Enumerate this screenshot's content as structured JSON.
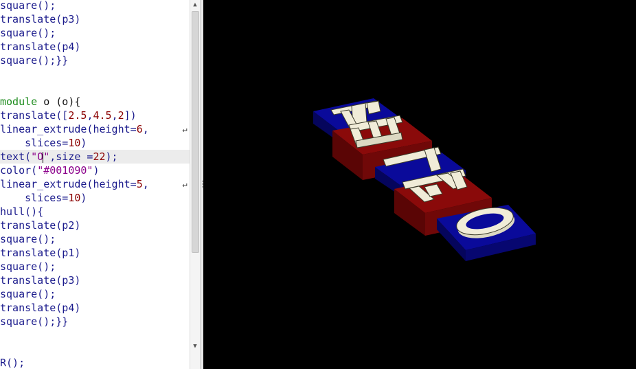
{
  "editor": {
    "lines": [
      {
        "segs": [
          {
            "t": "square();",
            "c": "fn"
          }
        ]
      },
      {
        "segs": [
          {
            "t": "translate(",
            "c": "fn"
          },
          {
            "t": "p3",
            "c": "fn"
          },
          {
            "t": ")",
            "c": "fn"
          }
        ]
      },
      {
        "segs": [
          {
            "t": "square();",
            "c": "fn"
          }
        ]
      },
      {
        "segs": [
          {
            "t": "translate(",
            "c": "fn"
          },
          {
            "t": "p4",
            "c": "fn"
          },
          {
            "t": ")",
            "c": "fn"
          }
        ]
      },
      {
        "segs": [
          {
            "t": "square();}}",
            "c": "fn"
          }
        ]
      },
      {
        "segs": []
      },
      {
        "segs": []
      },
      {
        "segs": [
          {
            "t": "module",
            "c": "kw"
          },
          {
            "t": " o (o){",
            "c": ""
          }
        ]
      },
      {
        "segs": [
          {
            "t": "translate([",
            "c": "fn"
          },
          {
            "t": "2.5",
            "c": "num"
          },
          {
            "t": ",",
            "c": "fn"
          },
          {
            "t": "4.5",
            "c": "num"
          },
          {
            "t": ",",
            "c": "fn"
          },
          {
            "t": "2",
            "c": "num"
          },
          {
            "t": "])",
            "c": "fn"
          }
        ]
      },
      {
        "segs": [
          {
            "t": "linear_extrude(height=",
            "c": "fn"
          },
          {
            "t": "6",
            "c": "num"
          },
          {
            "t": ",",
            "c": "fn"
          }
        ],
        "wrap": true
      },
      {
        "segs": [
          {
            "t": "    slices=",
            "c": "fn"
          },
          {
            "t": "10",
            "c": "num"
          },
          {
            "t": ")",
            "c": "fn"
          }
        ]
      },
      {
        "segs": [
          {
            "t": "text(",
            "c": "fn"
          },
          {
            "t": "\"O",
            "c": "str"
          },
          {
            "t": "CARET",
            "c": "caret"
          },
          {
            "t": "\"",
            "c": "str"
          },
          {
            "t": ",size =",
            "c": "fn"
          },
          {
            "t": "22",
            "c": "num"
          },
          {
            "t": ");",
            "c": "fn"
          }
        ],
        "current": true
      },
      {
        "segs": [
          {
            "t": "color(",
            "c": "fn"
          },
          {
            "t": "\"#001090\"",
            "c": "str"
          },
          {
            "t": ")",
            "c": "fn"
          }
        ]
      },
      {
        "segs": [
          {
            "t": "linear_extrude(height=",
            "c": "fn"
          },
          {
            "t": "5",
            "c": "num"
          },
          {
            "t": ",",
            "c": "fn"
          }
        ],
        "wrap": true
      },
      {
        "segs": [
          {
            "t": "    slices=",
            "c": "fn"
          },
          {
            "t": "10",
            "c": "num"
          },
          {
            "t": ")",
            "c": "fn"
          }
        ]
      },
      {
        "segs": [
          {
            "t": "hull(){",
            "c": "fn"
          }
        ]
      },
      {
        "segs": [
          {
            "t": "translate(p2)",
            "c": "fn"
          }
        ]
      },
      {
        "segs": [
          {
            "t": "square();",
            "c": "fn"
          }
        ]
      },
      {
        "segs": [
          {
            "t": "translate(p1)",
            "c": "fn"
          }
        ]
      },
      {
        "segs": [
          {
            "t": "square();",
            "c": "fn"
          }
        ]
      },
      {
        "segs": [
          {
            "t": "translate(p3)",
            "c": "fn"
          }
        ]
      },
      {
        "segs": [
          {
            "t": "square();",
            "c": "fn"
          }
        ]
      },
      {
        "segs": [
          {
            "t": "translate(p4)",
            "c": "fn"
          }
        ]
      },
      {
        "segs": [
          {
            "t": "square();}}",
            "c": "fn"
          }
        ]
      },
      {
        "segs": []
      },
      {
        "segs": []
      },
      {
        "segs": [
          {
            "t": "R();",
            "c": "fn"
          }
        ]
      }
    ],
    "wrap_icon": "↵"
  },
  "scrollbar": {
    "up_icon": "▲",
    "down_icon": "▼"
  },
  "viewport": {
    "scene": "3D render of extruded letters R E T R O on alternating blue and red blocks",
    "colors": {
      "background": "#000000",
      "blue_block": "#0a0a9a",
      "red_block": "#8a0a0a",
      "letters": "#f0ecd8"
    }
  }
}
